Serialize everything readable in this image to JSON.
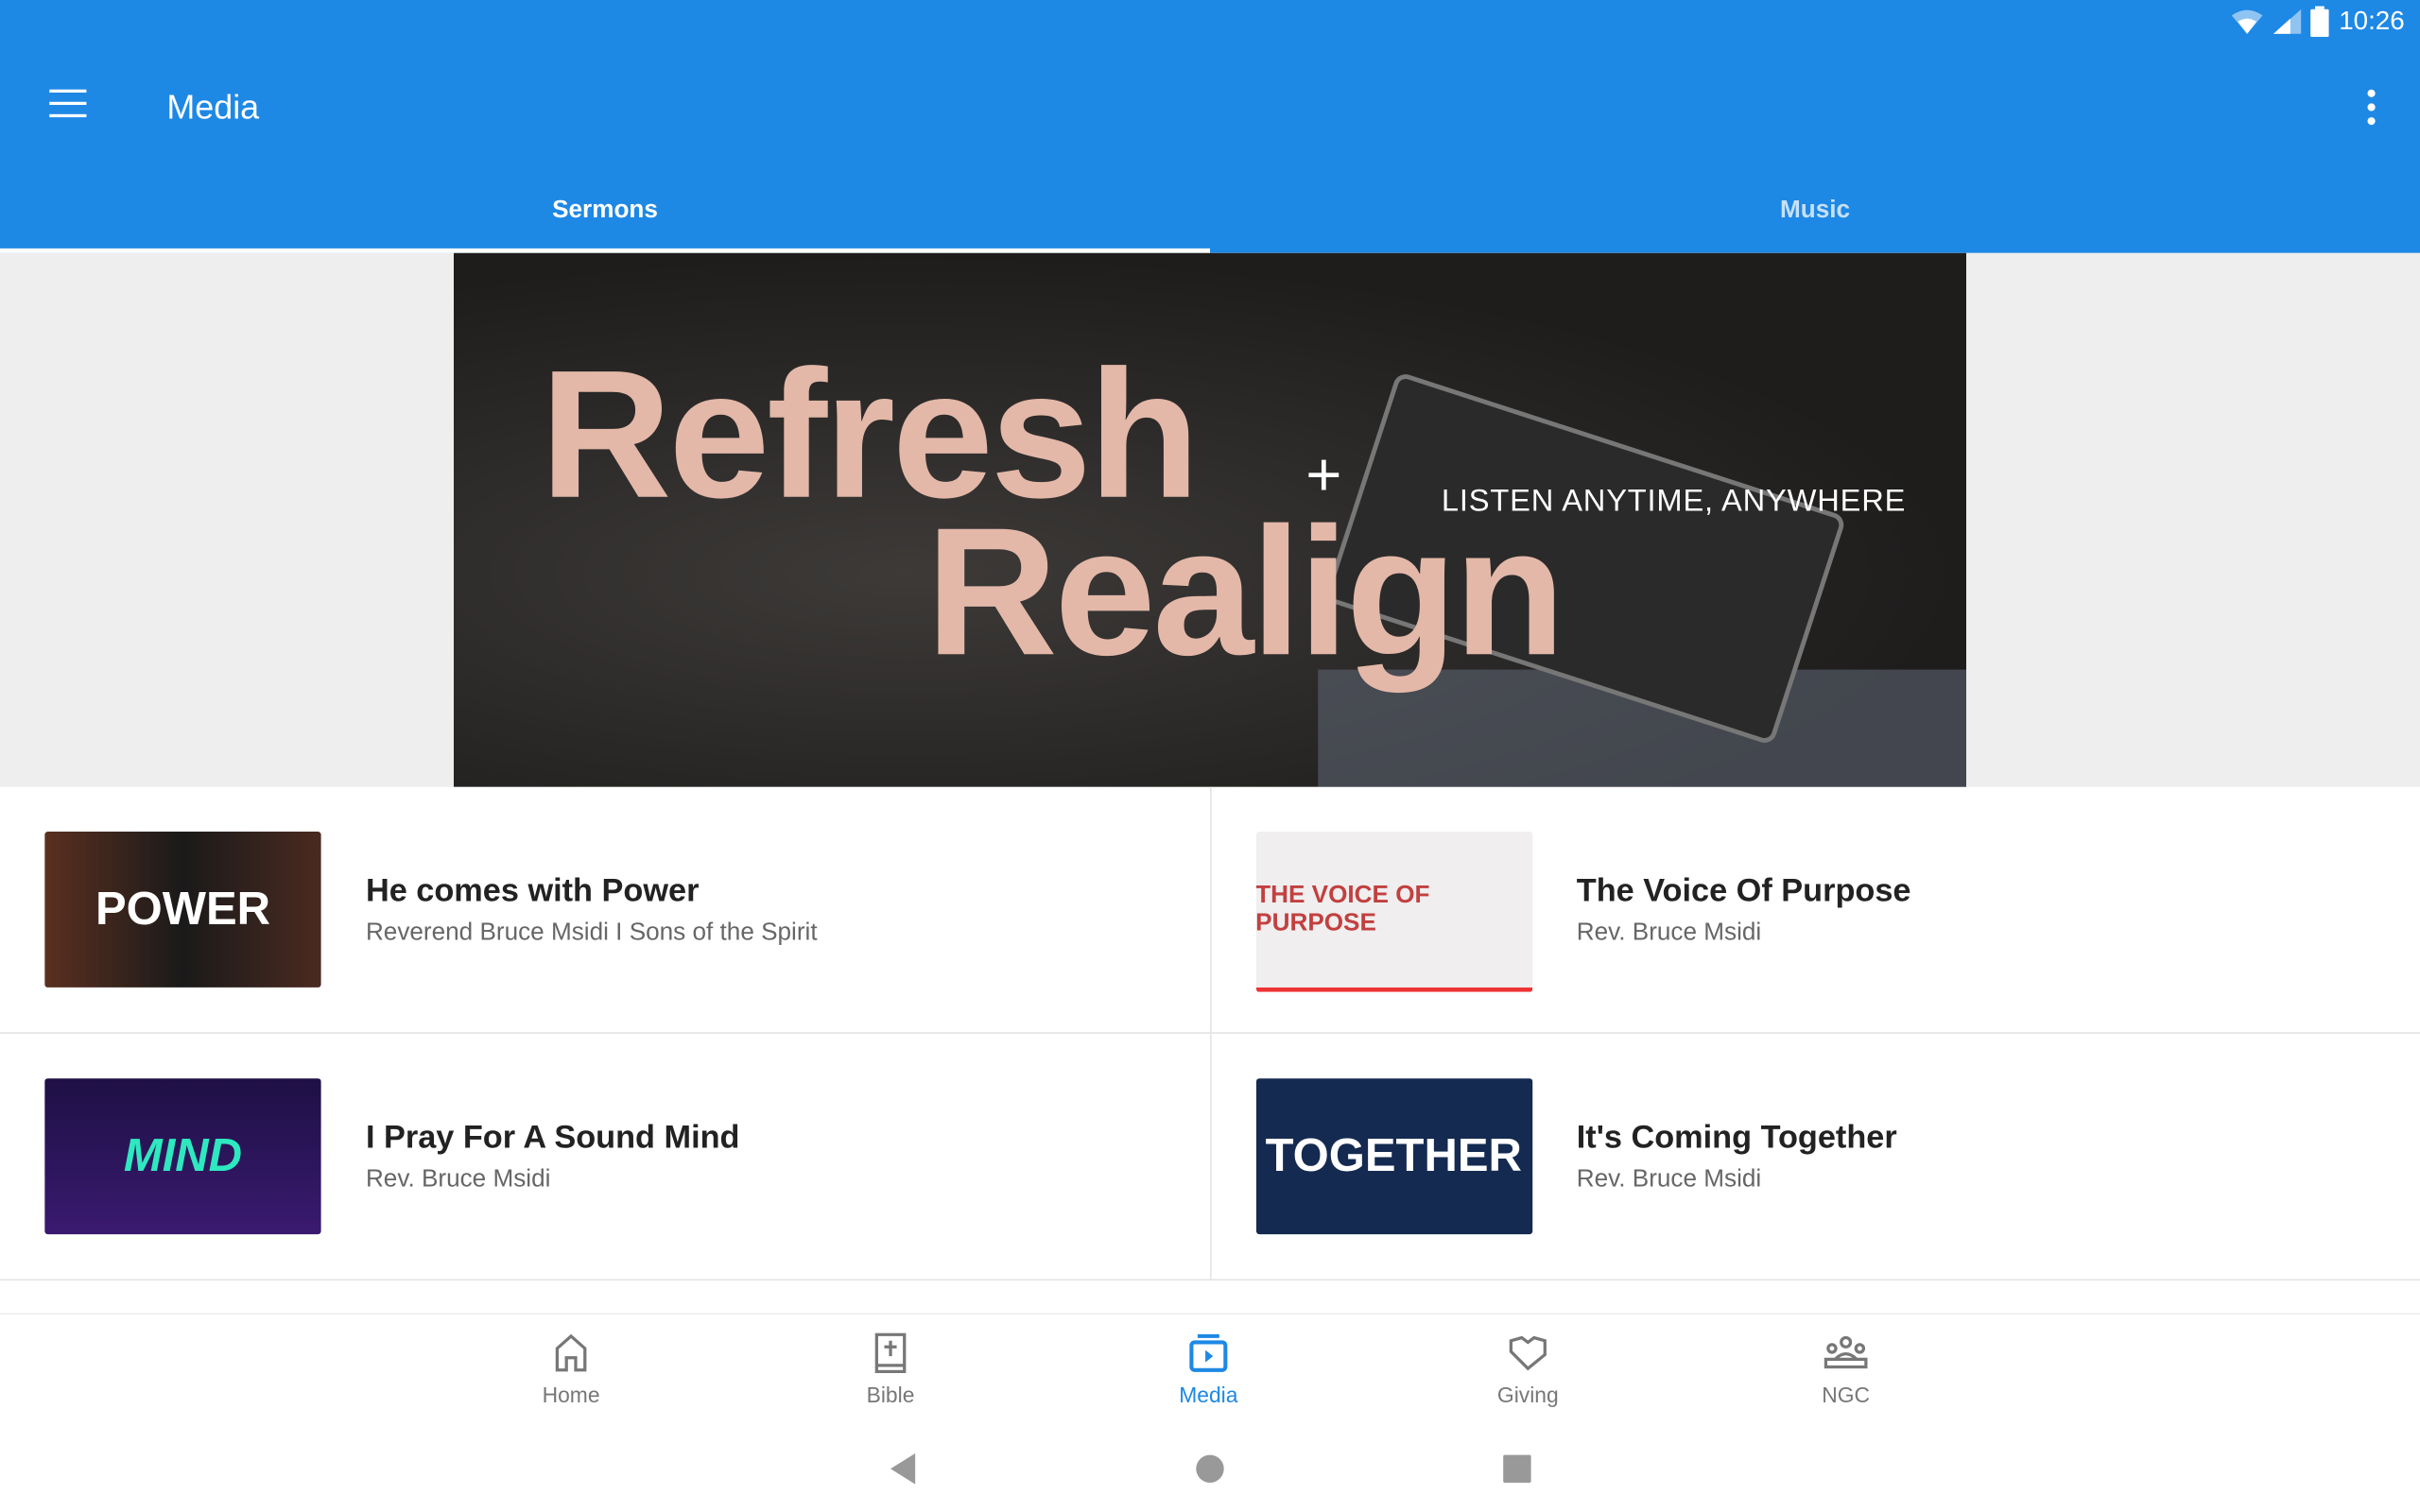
{
  "status": {
    "time": "10:26",
    "icons": [
      "wifi-icon",
      "signal-icon",
      "battery-icon"
    ]
  },
  "appbar": {
    "title": "Media",
    "menu_icon": "hamburger-menu-icon",
    "more_icon": "more-vert-icon"
  },
  "tabs": [
    {
      "label": "Sermons",
      "active": true
    },
    {
      "label": "Music",
      "active": false
    }
  ],
  "banner": {
    "line1": "Refresh",
    "plus": "+",
    "line2": "Realign",
    "tagline": "LISTEN ANYTIME, ANYWHERE"
  },
  "sermons": [
    {
      "title": "He comes with Power",
      "subtitle": "Reverend Bruce Msidi I Sons of the Spirit",
      "thumb_text": "POWER",
      "thumb_bg": "#3a2a22"
    },
    {
      "title": "The Voice Of Purpose",
      "subtitle": "Rev. Bruce Msidi",
      "thumb_text": "THE VOICE OF PURPOSE",
      "thumb_bg": "#eeeeee"
    },
    {
      "title": "I Pray For A Sound Mind",
      "subtitle": "Rev. Bruce Msidi",
      "thumb_text": "MIND",
      "thumb_bg": "#2a1a5a"
    },
    {
      "title": "It's Coming Together",
      "subtitle": "Rev. Bruce Msidi",
      "thumb_text": "TOGETHER",
      "thumb_bg": "#142a50"
    }
  ],
  "bottom_nav": [
    {
      "label": "Home",
      "icon": "home-icon",
      "active": false
    },
    {
      "label": "Bible",
      "icon": "bible-icon",
      "active": false
    },
    {
      "label": "Media",
      "icon": "media-icon",
      "active": true
    },
    {
      "label": "Giving",
      "icon": "giving-icon",
      "active": false
    },
    {
      "label": "NGC",
      "icon": "group-icon",
      "active": false
    }
  ],
  "colors": {
    "primary": "#1e88e5",
    "banner_text": "#e3b8a8"
  }
}
